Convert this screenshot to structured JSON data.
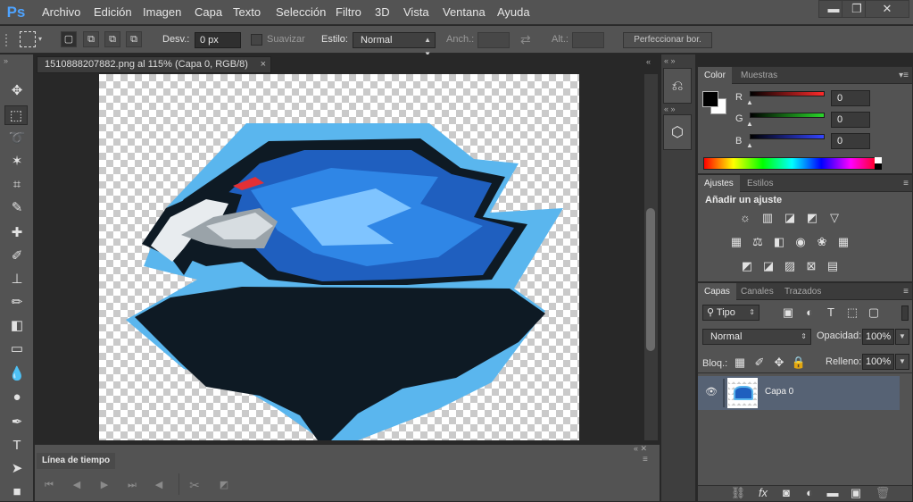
{
  "app": {
    "logo": "Ps",
    "accent": "#4ea3ff"
  },
  "menubar": {
    "items": [
      "Archivo",
      "Edición",
      "Imagen",
      "Capa",
      "Texto",
      "Selección",
      "Filtro",
      "3D",
      "Vista",
      "Ventana",
      "Ayuda"
    ],
    "window_buttons": {
      "minimize": "▬",
      "restore": "❐",
      "close": "✕"
    }
  },
  "options": {
    "feather_label": "Desv.:",
    "feather_value": "0 px",
    "antialias_label": "Suavizar",
    "style_label": "Estilo:",
    "style_value": "Normal",
    "width_label": "Anch.:",
    "height_label": "Alt.:",
    "refine_button": "Perfeccionar bor."
  },
  "document": {
    "tab_title": "1510888207882.png al 115% (Capa 0, RGB/8)",
    "close": "×",
    "has_vertical_scrollbar": true
  },
  "timeline": {
    "title": "Línea de tiempo"
  },
  "color_panel": {
    "tabs": [
      "Color",
      "Muestras"
    ],
    "channels": [
      {
        "label": "R",
        "value": "0",
        "color": "#ff2a2a"
      },
      {
        "label": "G",
        "value": "0",
        "color": "#2ad62a"
      },
      {
        "label": "B",
        "value": "0",
        "color": "#3344ff"
      }
    ],
    "foreground": "#000000",
    "background": "#ffffff"
  },
  "adjustments_panel": {
    "tabs": [
      "Ajustes",
      "Estilos"
    ],
    "heading": "Añadir un ajuste"
  },
  "layers_panel": {
    "tabs": [
      "Capas",
      "Canales",
      "Trazados"
    ],
    "filter_label": "Tipo",
    "blend_mode": "Normal",
    "opacity_label": "Opacidad:",
    "opacity_value": "100%",
    "lock_label": "Bloq.:",
    "fill_label": "Relleno:",
    "fill_value": "100%",
    "layers": [
      {
        "name": "Capa 0",
        "visible": true,
        "selected": true
      }
    ],
    "selected_color": "#566274"
  }
}
